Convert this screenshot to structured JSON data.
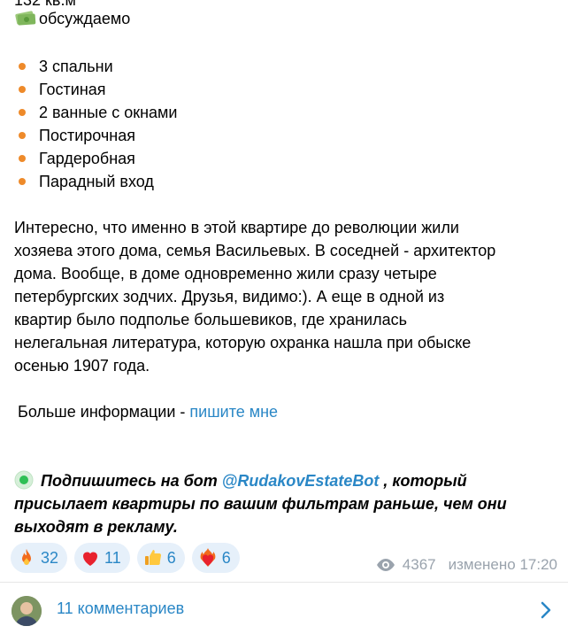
{
  "post": {
    "area_text": "132 кв.м",
    "price_text": "обсуждаемо",
    "features": [
      "3 спальни",
      "Гостиная",
      "2 ванные с окнами",
      "Постирочная",
      "Гардеробная",
      "Парадный вход"
    ],
    "paragraph_lines": [
      "Интересно, что именно в этой квартире до революции жили",
      "хозяева этого дома, семья Васильевых. В соседней - архитектор",
      "дома. Вообще, в доме одновременно жили сразу четыре",
      "петербургских зодчих. Друзья, видимо:). А еще в одной из",
      "квартир было подполье большевиков, где хранилась",
      "нелегальная литература, которую охранка нашла при обыске",
      "осенью 1907 года."
    ],
    "more_info_text": "Больше информации - ",
    "more_info_link": "пишите мне",
    "subscribe_text_1": "Подпишитесь на бот ",
    "subscribe_bot_link": "@RudakovEstateBot",
    "subscribe_text_2": " , который",
    "subscribe_line_2": "присылает квартиры по вашим фильтрам раньше, чем они",
    "subscribe_line_3": "выходят в рекламу."
  },
  "reactions": [
    {
      "icon": "fire-icon",
      "count": "32"
    },
    {
      "icon": "heart-icon",
      "count": "11"
    },
    {
      "icon": "thumbs-up-icon",
      "count": "6"
    },
    {
      "icon": "heart-on-fire-icon",
      "count": "6"
    }
  ],
  "meta": {
    "views": "4367",
    "edited_time": "изменено 17:20"
  },
  "comments": {
    "label": "11 комментариев"
  },
  "colors": {
    "accent": "#2a87c6",
    "bullet": "#ee8a2a",
    "reaction_bg": "#e6f0fa",
    "meta": "#9aa3ad"
  }
}
